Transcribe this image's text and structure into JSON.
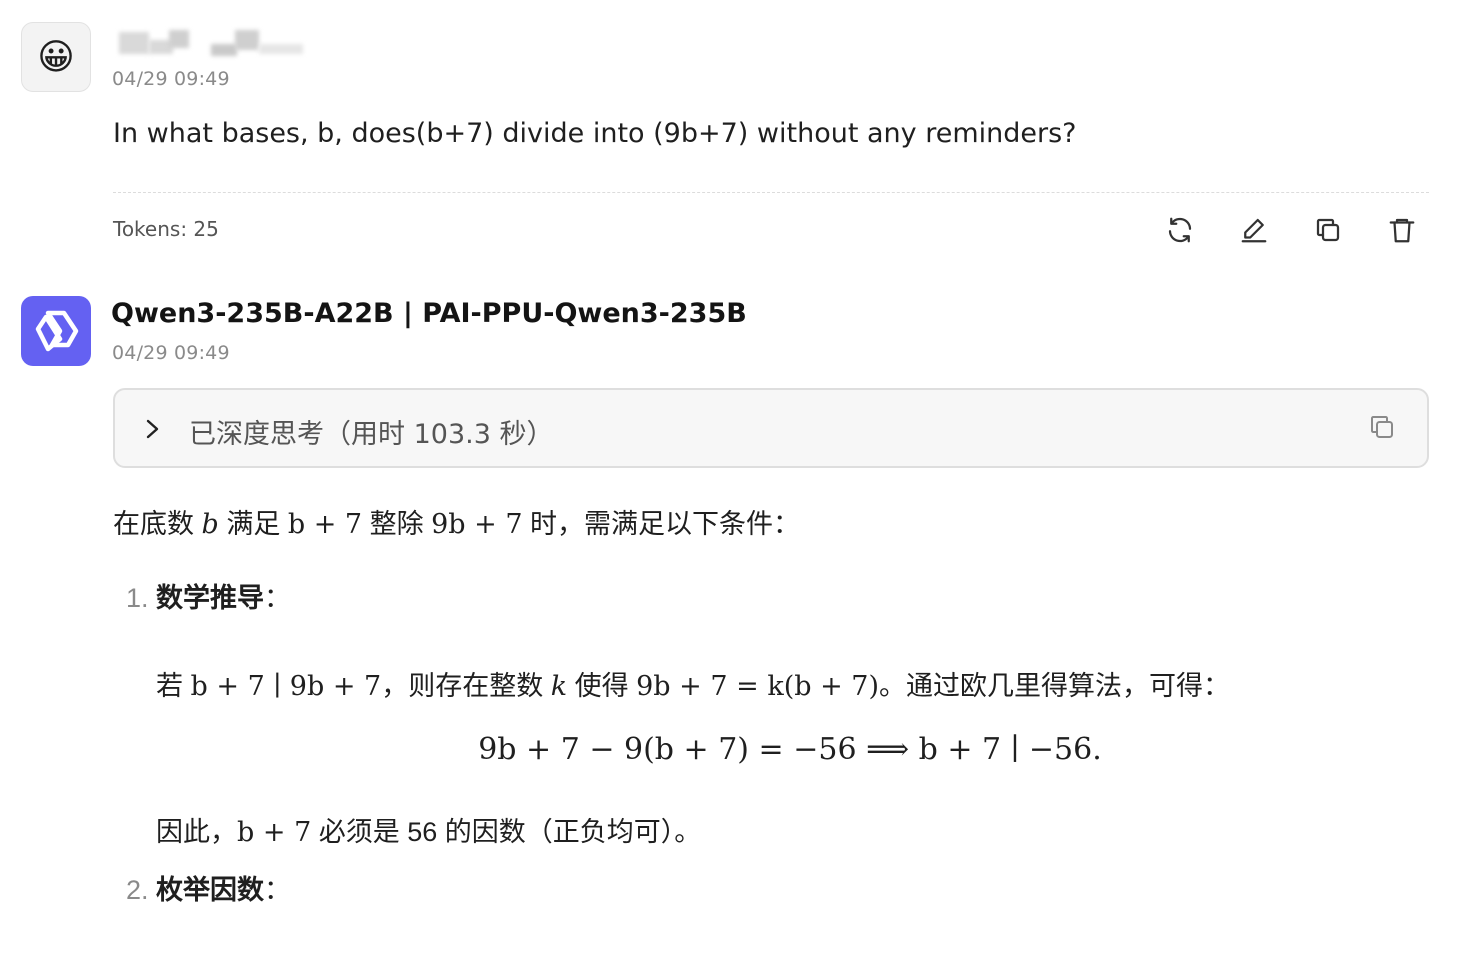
{
  "user_message": {
    "avatar_icon": "grinning-face-emoji",
    "avatar_glyph": "😀",
    "timestamp": "04/29 09:49",
    "text": "In what bases, b, does(b+7) divide into (9b+7) without any reminders?",
    "tokens_label": "Tokens: 25"
  },
  "actions": [
    {
      "name": "regenerate-icon"
    },
    {
      "name": "edit-icon"
    },
    {
      "name": "copy-icon"
    },
    {
      "name": "delete-icon"
    }
  ],
  "assistant_message": {
    "avatar_icon": "qwen-logo-icon",
    "model_name": "Qwen3-235B-A22B | PAI-PPU-Qwen3-235B",
    "timestamp": "04/29 09:49",
    "thinking_label": "已深度思考（用时 103.3 秒）",
    "intro": {
      "p1": "在底数 ",
      "m1": "b",
      "p2": " 满足 ",
      "m2": "b + 7",
      "p3": " 整除 ",
      "m3": "9b + 7",
      "p4": " 时，需满足以下条件："
    },
    "list": [
      {
        "num": "1.",
        "title": "数学推导",
        "colon": "："
      },
      {
        "num": "2.",
        "title": "枚举因数",
        "colon": "："
      }
    ],
    "derive": {
      "p1": "若 ",
      "m1": "b + 7 ∣ 9b + 7",
      "p2": "，则存在整数 ",
      "m2": "k",
      "p3": " 使得 ",
      "m3": "9b + 7 = k(b + 7)",
      "p4": "。通过欧几里得算法，可得："
    },
    "equation": "9b + 7 − 9(b + 7) = −56  ⟹  b + 7 ∣ −56.",
    "therefore": {
      "p1": "因此，",
      "m1": "b + 7",
      "p2": " 必须是 56 的因数（正负均可）。"
    }
  },
  "colors": {
    "bot_avatar_bg": "#6461f2",
    "think_box_bg": "#f7f7f7",
    "muted_text": "#8a8a8a"
  }
}
